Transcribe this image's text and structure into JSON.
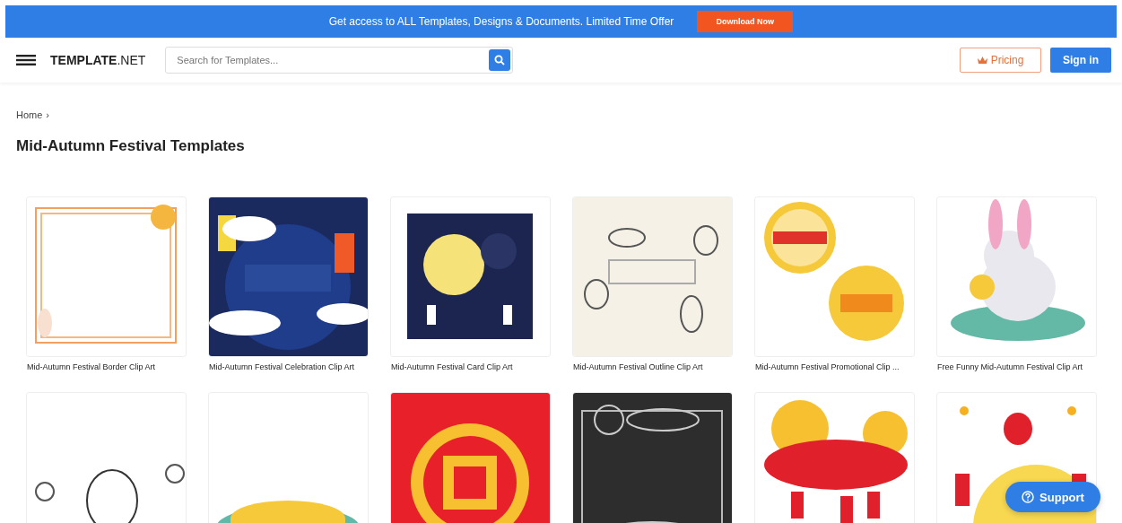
{
  "promo_banner": {
    "text": "Get access to ALL Templates, Designs & Documents. Limited Time Offer",
    "button": "Download Now"
  },
  "header": {
    "logo_bold": "TEMPLATE",
    "logo_light": ".NET",
    "search": {
      "placeholder": "Search for Templates..."
    },
    "pricing_button": "Pricing",
    "signin_button": "Sign in"
  },
  "breadcrumb": [
    "Home",
    "›"
  ],
  "page_title": "Mid-Autumn Festival Templates",
  "templates": [
    {
      "kind": "picture",
      "title": "Mid-Autumn Festival Border Clip Art"
    },
    {
      "kind": "picture",
      "title": "Mid-Autumn Festival Celebration Clip Art"
    },
    {
      "kind": "picture",
      "title": "Mid-Autumn Festival Card Clip Art"
    },
    {
      "kind": "picture",
      "title": "Mid-Autumn Festival Outline Clip Art"
    },
    {
      "kind": "picture",
      "title": "Mid-Autumn Festival Promotional Clip ..."
    },
    {
      "kind": "picture",
      "title": "Free Funny Mid-Autumn Festival Clip Art"
    },
    {
      "kind": "picture"
    },
    {
      "kind": "picture"
    },
    {
      "kind": "picture"
    },
    {
      "kind": "picture"
    },
    {
      "kind": "picture"
    },
    {
      "kind": "picture"
    }
  ],
  "support_button": "Support"
}
